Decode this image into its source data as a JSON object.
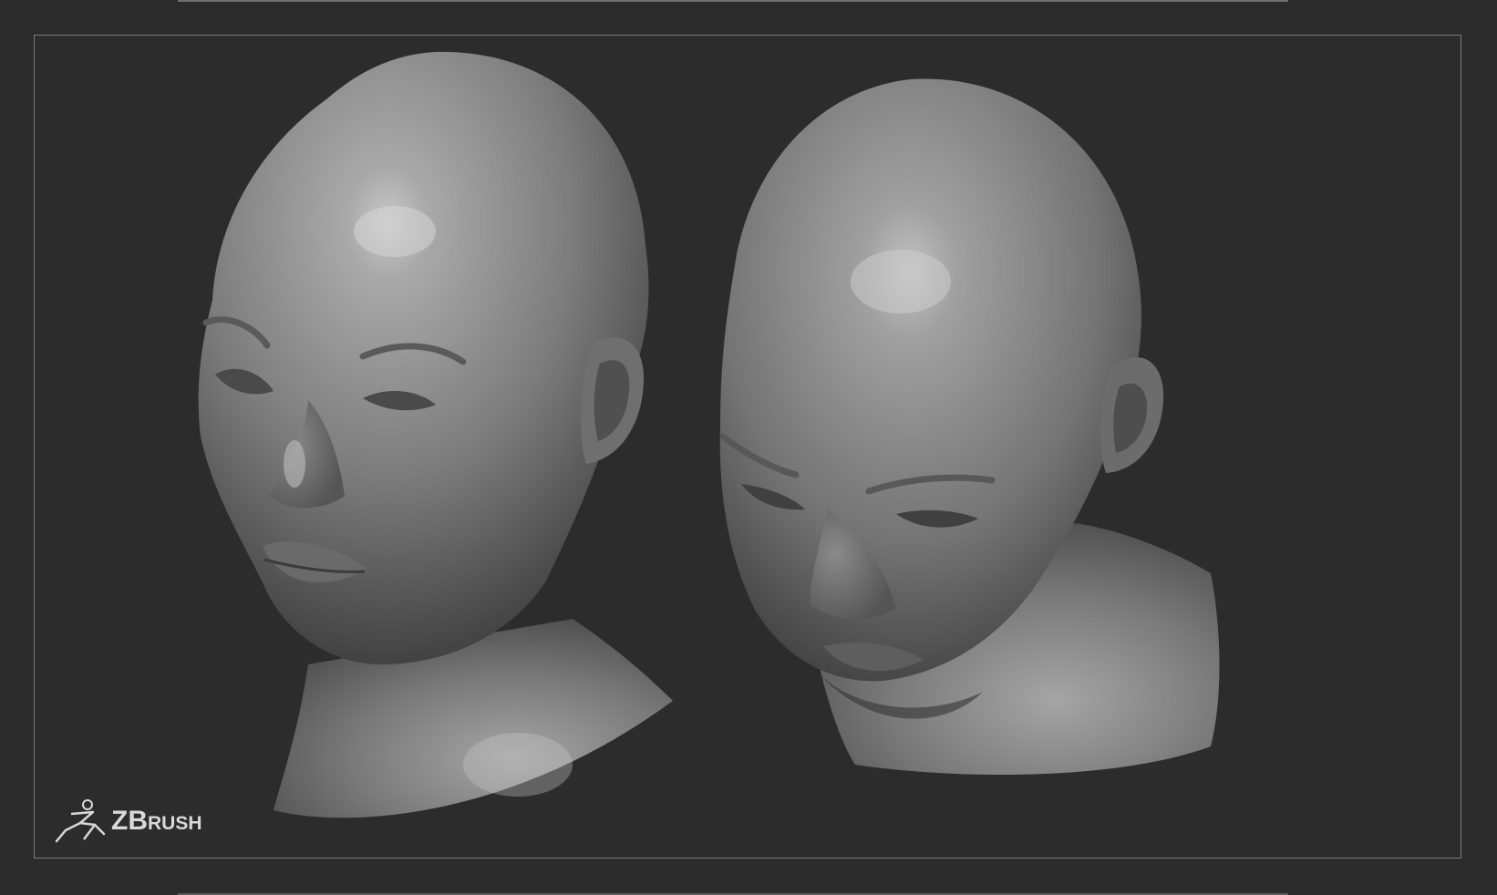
{
  "app": {
    "brand_text": "ZBrush"
  },
  "viewport": {
    "background_color": "#2c2c2c",
    "frame_color": "#7a7a7a",
    "objects": [
      {
        "name": "head-sculpt-front",
        "description_icon": "head-three-quarter-view"
      },
      {
        "name": "head-sculpt-tilted",
        "description_icon": "head-looking-down-view"
      }
    ]
  },
  "colors": {
    "page_background": "#2b2b2b",
    "clay_light": "#a7a7a7",
    "clay_mid": "#7d7d7d",
    "clay_dark": "#4a4a4a",
    "logo": "#d9d9d9"
  }
}
